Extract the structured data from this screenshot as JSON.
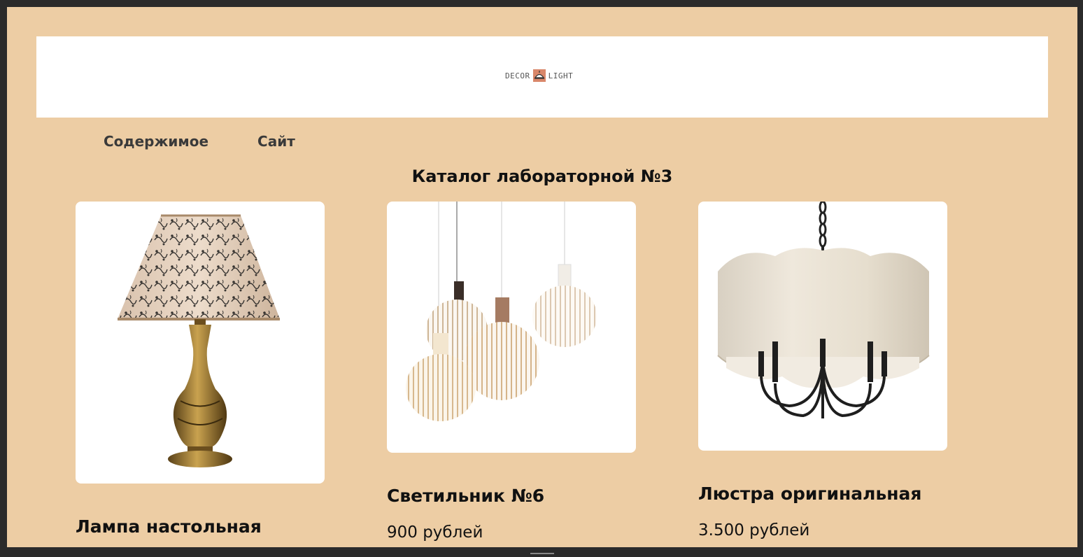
{
  "header": {
    "logo_left": "DECOR",
    "logo_right": "LIGHT"
  },
  "nav": {
    "items": [
      {
        "label": "Содержимое"
      },
      {
        "label": "Сайт"
      }
    ]
  },
  "page": {
    "title": "Каталог лабораторной №3"
  },
  "products": [
    {
      "title": "Лампа настольная",
      "price": "",
      "image_icon": "table-lamp-image"
    },
    {
      "title": "Светильник №6",
      "price": "900 рублей",
      "image_icon": "pendant-lights-image"
    },
    {
      "title": "Люстра оригинальная",
      "price": "3.500 рублей",
      "image_icon": "chandelier-image"
    }
  ],
  "colors": {
    "page_background": "#edcda4",
    "header_background": "#ffffff",
    "logo_accent": "#d9876a"
  }
}
